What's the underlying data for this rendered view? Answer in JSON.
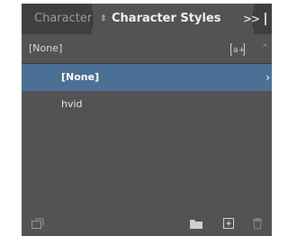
{
  "tabs": {
    "inactive_label": "Character",
    "active_label": "Character Styles",
    "overflow_label": ">>"
  },
  "header": {
    "current_style": "[None]",
    "new_group_icon": "style-override-icon",
    "collapse_icon": "chevron-up-icon"
  },
  "styles": [
    {
      "label": "[None]",
      "selected": true
    },
    {
      "label": "hvid",
      "selected": false
    }
  ],
  "footer": {
    "icons": [
      "load-styles-icon",
      "folder-icon",
      "new-style-icon",
      "trash-icon"
    ]
  },
  "colors": {
    "panel_bg": "#535353",
    "tabbar_bg": "#3f3f3f",
    "selection": "#4c6f95"
  }
}
